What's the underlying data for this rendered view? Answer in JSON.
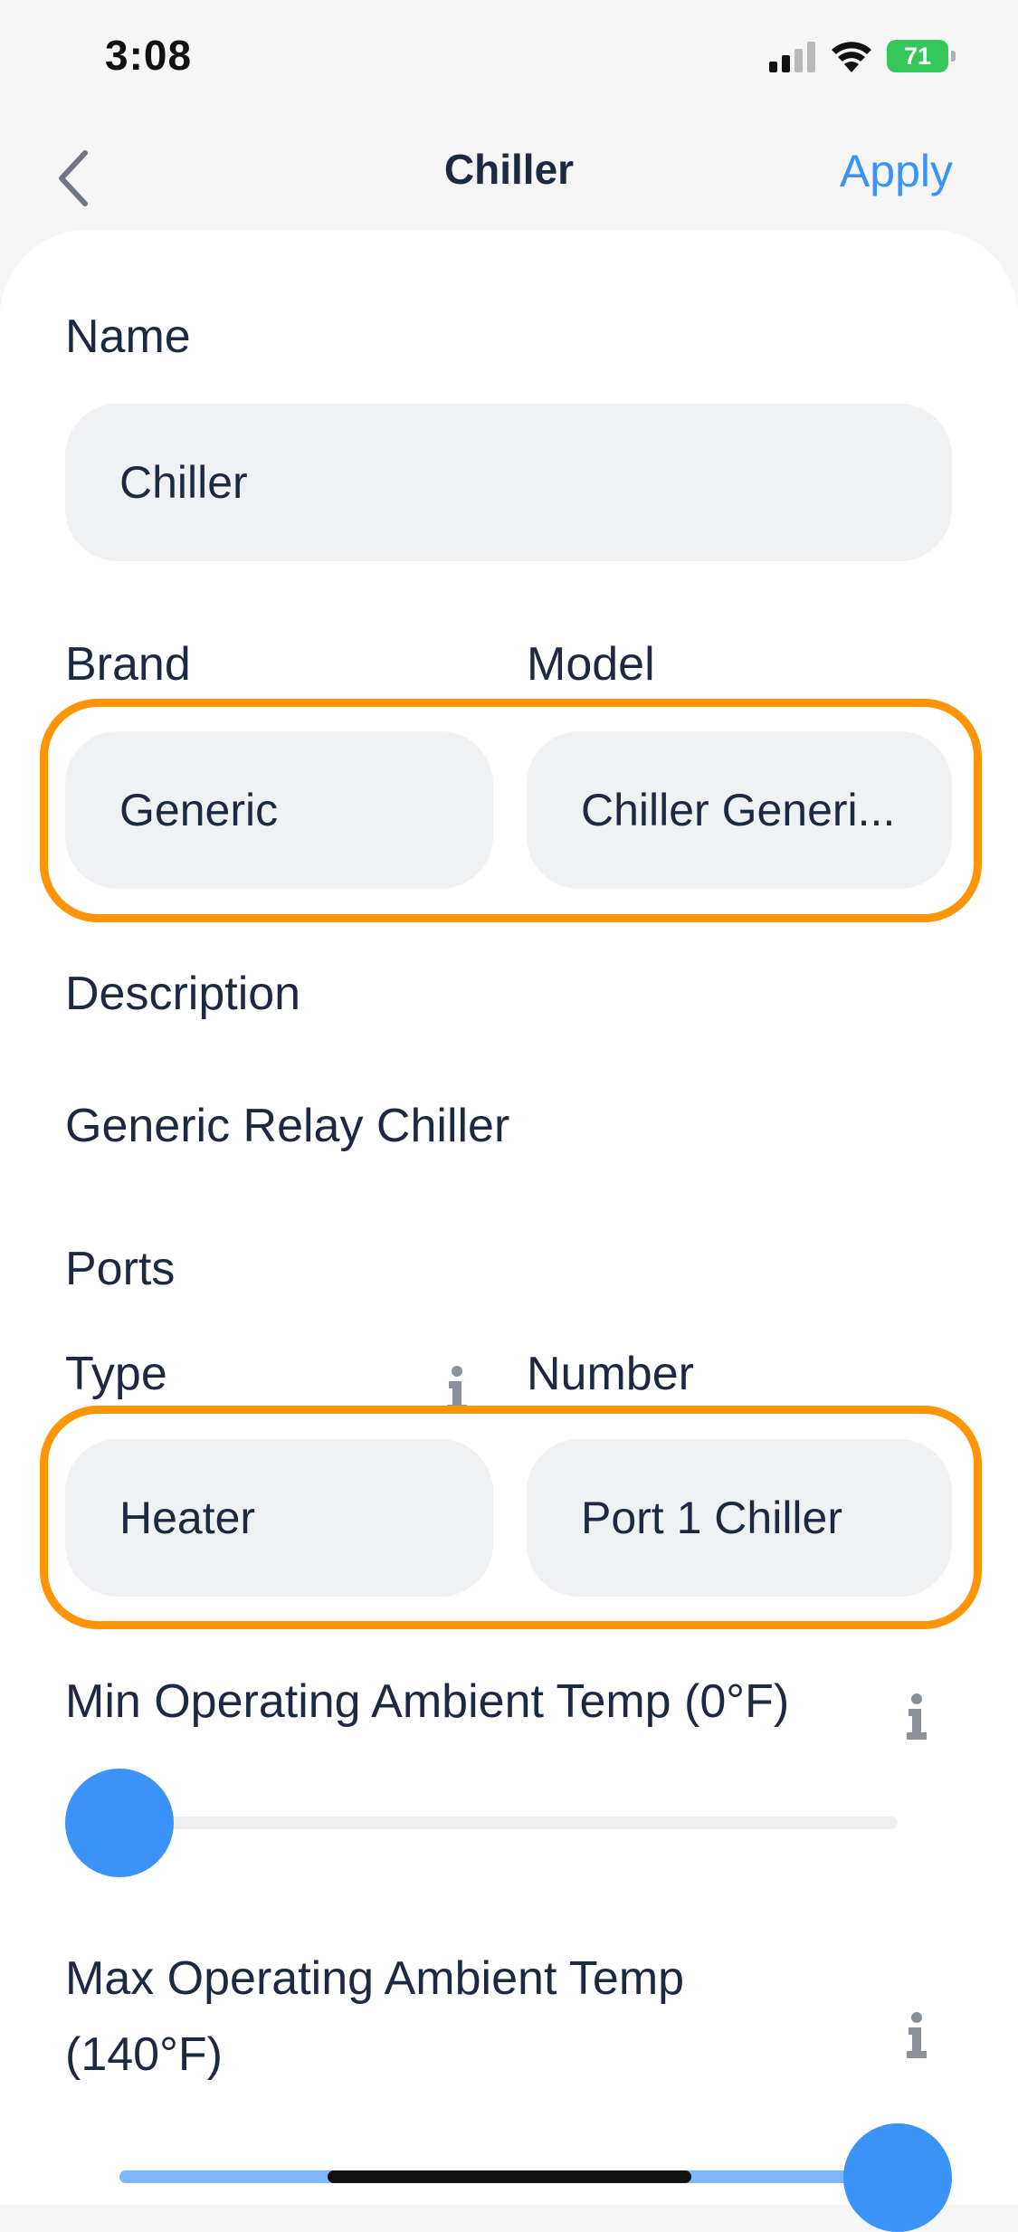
{
  "status_bar": {
    "time": "3:08",
    "battery_level": "71",
    "icons": [
      "signal-icon",
      "wifi-icon",
      "battery-charging-icon"
    ]
  },
  "nav": {
    "title": "Chiller",
    "apply_label": "Apply",
    "back_icon": "chevron-left-icon"
  },
  "form": {
    "name_label": "Name",
    "name_value": "Chiller",
    "brand_label": "Brand",
    "brand_value": "Generic",
    "model_label": "Model",
    "model_value": "Chiller Generi...",
    "description_label": "Description",
    "description_value": "Generic Relay Chiller",
    "ports_label": "Ports",
    "type_label": "Type",
    "type_value": "Heater",
    "number_label": "Number",
    "number_value": "Port 1 Chiller",
    "min_temp_label": "Min Operating Ambient Temp (0°F)",
    "min_temp_value_f": 0,
    "max_temp_label_line1": "Max Operating Ambient Temp",
    "max_temp_label_line2": "(140°F)",
    "max_temp_value_f": 140
  },
  "colors": {
    "accent": "#3b93f7",
    "highlight": "#ff9506",
    "text": "#1c2940",
    "field_bg": "#f0f1f3",
    "battery": "#35c759"
  }
}
